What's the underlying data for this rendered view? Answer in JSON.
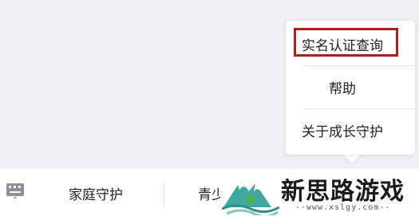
{
  "popup_menu": {
    "items": [
      {
        "label": "实名认证查询"
      },
      {
        "label": "帮助"
      },
      {
        "label": "关于成长守护"
      }
    ]
  },
  "tab_bar": {
    "keyboard_icon": "keyboard-icon",
    "tabs": [
      {
        "label": "家庭守护"
      },
      {
        "label": "青少"
      }
    ]
  },
  "watermark": {
    "title": "新思路游戏",
    "url": "--www.xslgy.com--"
  },
  "colors": {
    "highlight_border": "#a3231f",
    "background": "#eef0f5"
  }
}
